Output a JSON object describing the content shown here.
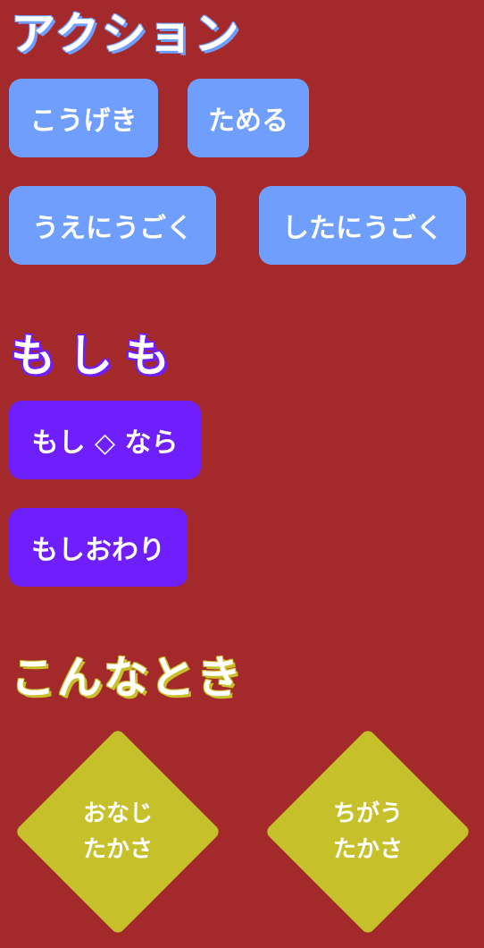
{
  "sections": {
    "action": {
      "title": "アクション",
      "buttons": {
        "attack": "こうげき",
        "charge": "ためる",
        "move_up": "うえにうごく",
        "move_down": "したにうごく"
      }
    },
    "if": {
      "title": "もしも",
      "buttons": {
        "if_start": "もし ◇ なら",
        "if_end": "もしおわり"
      }
    },
    "when": {
      "title": "こんなとき",
      "conditions": {
        "same": {
          "line1": "おなじ",
          "line2": "たかさ"
        },
        "different": {
          "line1": "ちがう",
          "line2": "たかさ"
        }
      }
    }
  },
  "colors": {
    "background": "#a4292a",
    "action_blue": "#6f9efc",
    "if_purple": "#6e1ffb",
    "when_yellow": "#c6c02a"
  }
}
